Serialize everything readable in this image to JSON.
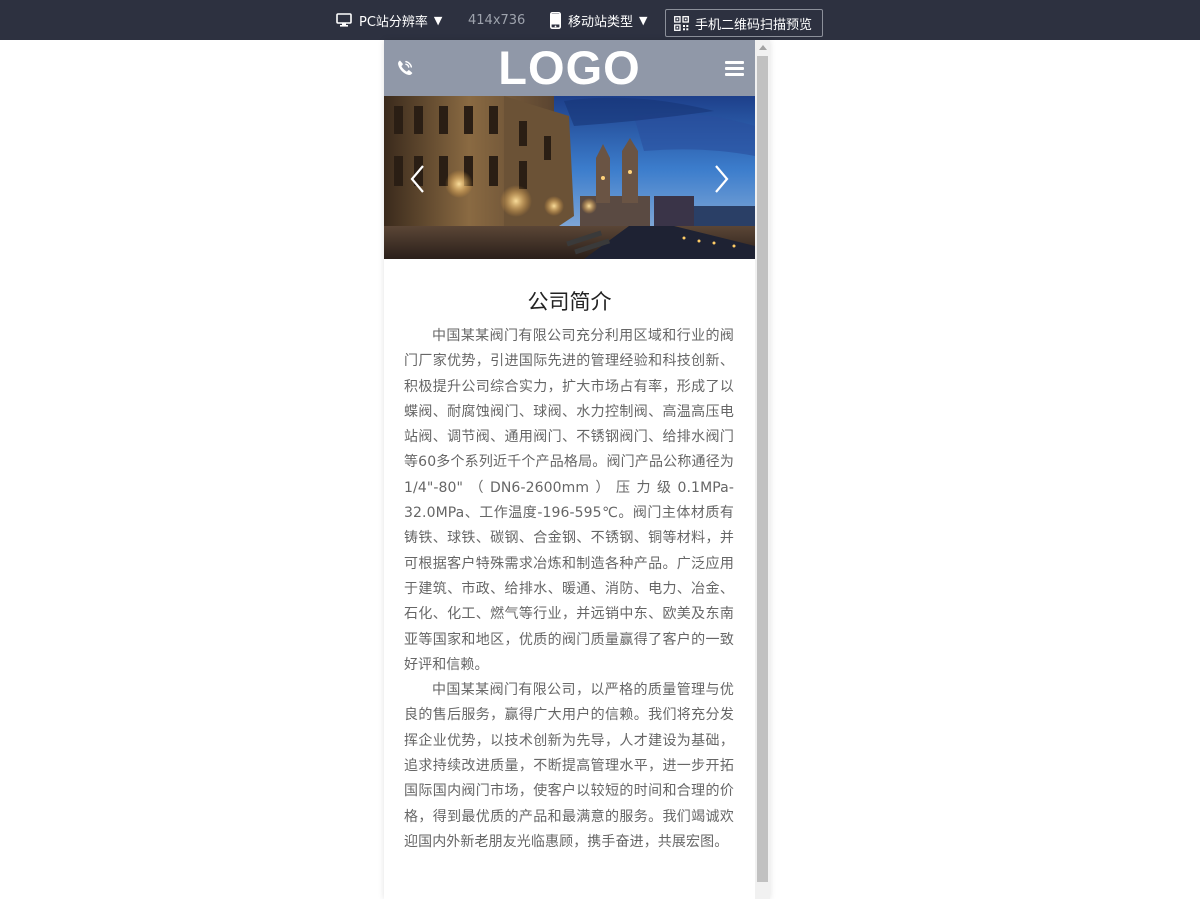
{
  "toolbar": {
    "pc_label": "PC站分辨率",
    "resolution": "414x736",
    "mobile_label": "移动站类型",
    "qr_label": "手机二维码扫描预览",
    "caret": "▼",
    "bg_color": "#2d3140"
  },
  "site": {
    "logo": "LOGO",
    "header_color": "#9098a8",
    "banner": {
      "alt_icons": [
        "chevron-left-icon",
        "chevron-right-icon"
      ]
    },
    "intro": {
      "title": "公司简介",
      "paragraphs": [
        "中国某某阀门有限公司充分利用区域和行业的阀门厂家优势，引进国际先进的管理经验和科技创新、积极提升公司综合实力，扩大市场占有率，形成了以蝶阀、耐腐蚀阀门、球阀、水力控制阀、高温高压电站阀、调节阀、通用阀门、不锈钢阀门、给排水阀门等60多个系列近千个产品格局。阀门产品公称通径为1/4\"-80\"（DN6-2600mm）压力级0.1MPa-32.0MPa、工作温度-196-595℃。阀门主体材质有铸铁、球铁、碳钢、合金钢、不锈钢、铜等材料，并可根据客户特殊需求冶炼和制造各种产品。广泛应用于建筑、市政、给排水、暖通、消防、电力、冶金、石化、化工、燃气等行业，并远销中东、欧美及东南亚等国家和地区，优质的阀门质量赢得了客户的一致好评和信赖。",
        "中国某某阀门有限公司，以严格的质量管理与优良的售后服务，赢得广大用户的信赖。我们将充分发挥企业优势，以技术创新为先导，人才建设为基础，追求持续改进质量，不断提高管理水平，进一步开拓国际国内阀门市场，使客户以较短的时间和合理的价格，得到最优质的产品和最满意的服务。我们竭诚欢迎国内外新老朋友光临惠顾，携手奋进，共展宏图。"
      ]
    }
  }
}
